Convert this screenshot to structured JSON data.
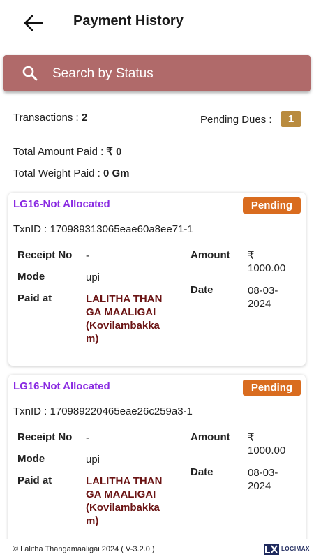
{
  "header": {
    "title": "Payment History",
    "back_icon": "arrow-left-icon"
  },
  "search": {
    "placeholder": "Search by Status",
    "value": "",
    "icon": "search-icon",
    "bar_color": "#b06a6a"
  },
  "summary": {
    "transactions_label": "Transactions : ",
    "transactions_count": "2",
    "pending_dues_label": "Pending Dues : ",
    "pending_dues_count": "1",
    "total_amount_label": "Total Amount Paid : ",
    "total_amount_value": "₹ 0",
    "total_weight_label": "Total Weight Paid : ",
    "total_weight_value": "0 Gm"
  },
  "labels": {
    "receipt_no": "Receipt No",
    "mode": "Mode",
    "paid_at": "Paid at",
    "amount": "Amount",
    "date": "Date"
  },
  "transactions": [
    {
      "title": "LG16-Not Allocated",
      "status": "Pending",
      "txn_id": "TxnID : 170989313065eae60a8ee71-1",
      "receipt_no": "-",
      "mode": "upi",
      "paid_at": "LALITHA THANGA MAALIGAI (Kovilambakkam)",
      "amount_symbol": "₹",
      "amount": "1000.00",
      "date_part1": "08-03-",
      "date_part2": "2024"
    },
    {
      "title": "LG16-Not Allocated",
      "status": "Pending",
      "txn_id": "TxnID : 170989220465eae26c259a3-1",
      "receipt_no": "-",
      "mode": "upi",
      "paid_at": "LALITHA THANGA MAALIGAI (Kovilambakkam)",
      "amount_symbol": "₹",
      "amount": "1000.00",
      "date_part1": "08-03-",
      "date_part2": "2024"
    }
  ],
  "footer": {
    "copyright": "© Lalitha Thangamaaligai 2024 ( V-3.2.0 )",
    "logo_text": "LOGIMAX"
  },
  "colors": {
    "title_purple": "#8a2be2",
    "status_orange": "#d96c1f",
    "badge_gold": "#b98b3e",
    "paid_at_maroon": "#6b1414"
  }
}
